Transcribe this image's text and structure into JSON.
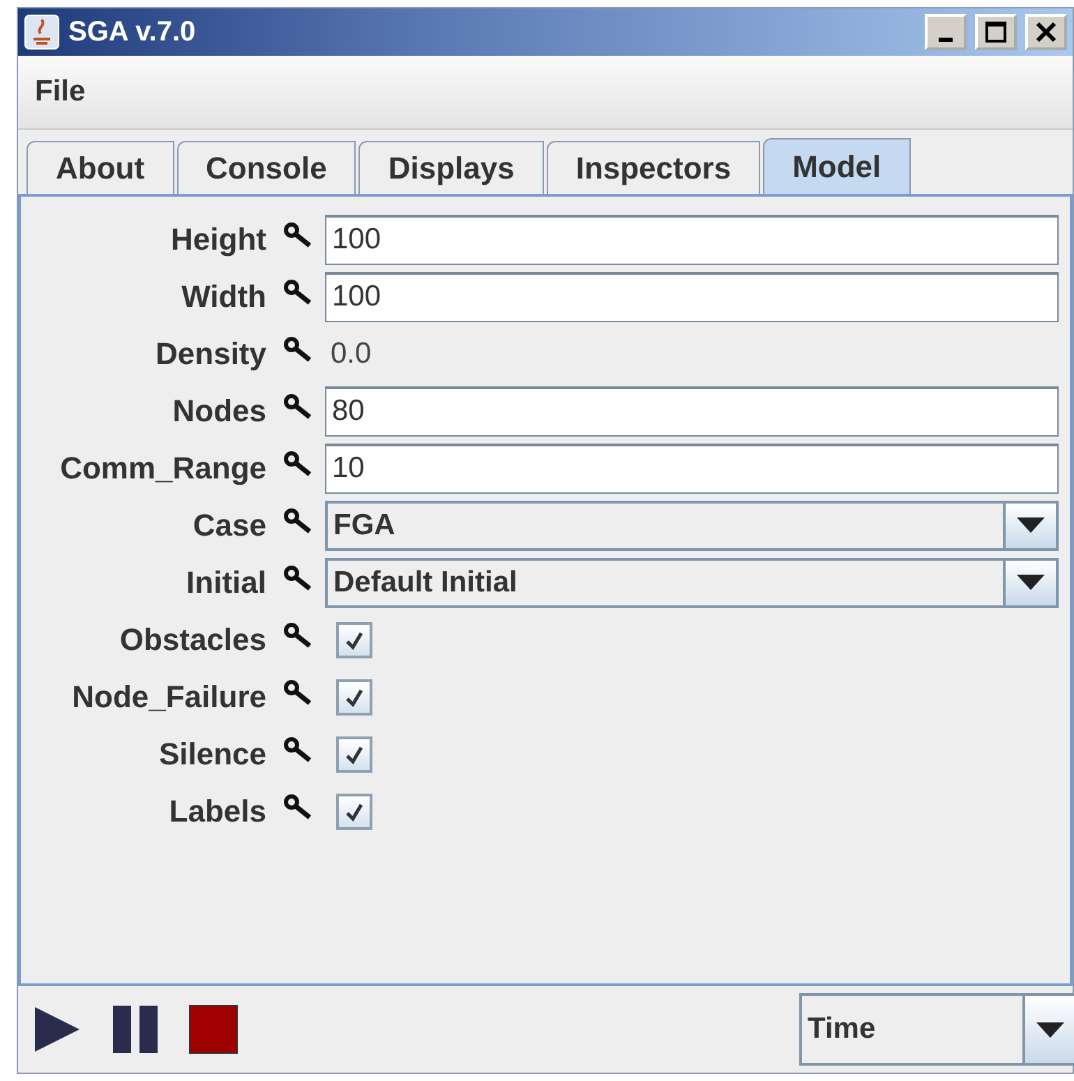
{
  "window": {
    "title": "SGA v.7.0"
  },
  "menu": [
    "File"
  ],
  "tabs": [
    {
      "label": "About",
      "selected": false
    },
    {
      "label": "Console",
      "selected": false
    },
    {
      "label": "Displays",
      "selected": false
    },
    {
      "label": "Inspectors",
      "selected": false
    },
    {
      "label": "Model",
      "selected": true
    }
  ],
  "properties": [
    {
      "label": "Height",
      "kind": "text",
      "value": "100"
    },
    {
      "label": "Width",
      "kind": "text",
      "value": "100"
    },
    {
      "label": "Density",
      "kind": "readonly",
      "value": "0.0"
    },
    {
      "label": "Nodes",
      "kind": "text",
      "value": "80"
    },
    {
      "label": "Comm_Range",
      "kind": "text",
      "value": "10"
    },
    {
      "label": "Case",
      "kind": "combo",
      "value": "FGA"
    },
    {
      "label": "Initial",
      "kind": "combo",
      "value": "Default Initial"
    },
    {
      "label": "Obstacles",
      "kind": "checkbox",
      "checked": true
    },
    {
      "label": "Node_Failure",
      "kind": "checkbox",
      "checked": true
    },
    {
      "label": "Silence",
      "kind": "checkbox",
      "checked": true
    },
    {
      "label": "Labels",
      "kind": "checkbox",
      "checked": true
    }
  ],
  "chart_selector": {
    "value": "Time"
  }
}
